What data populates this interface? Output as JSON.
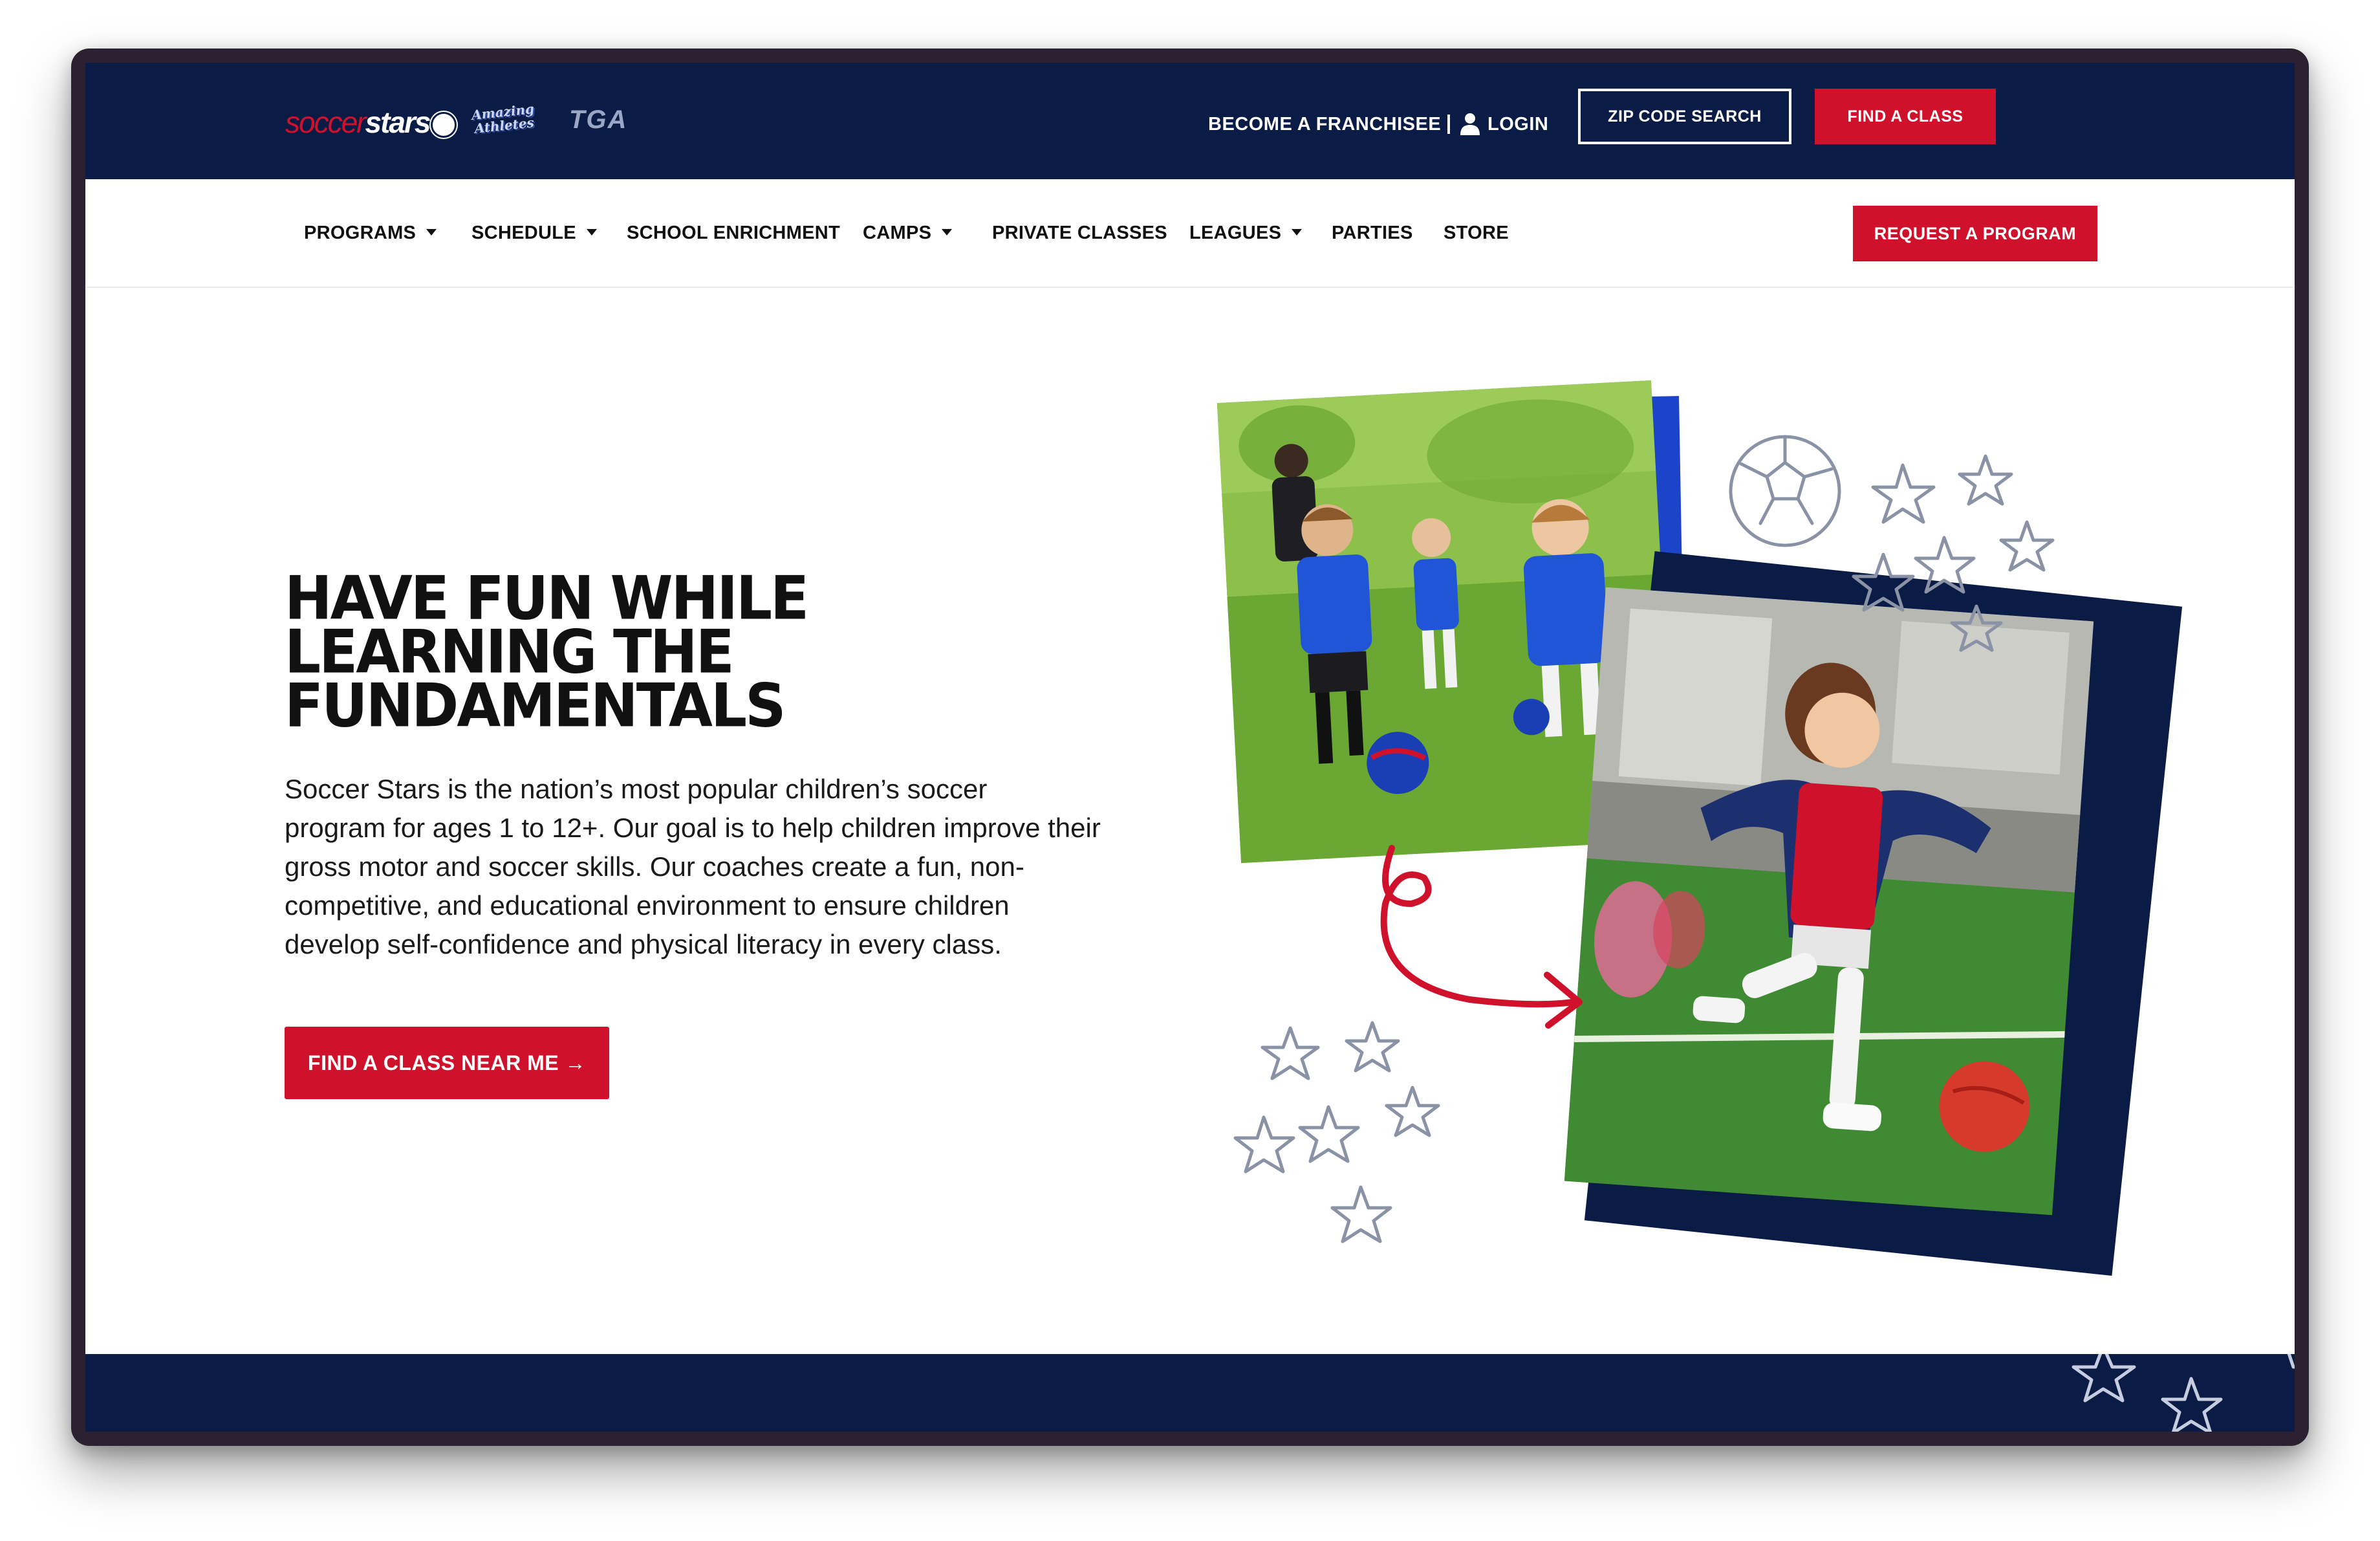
{
  "colors": {
    "navy": "#0a1b45",
    "red": "#d0112b",
    "white": "#ffffff",
    "text": "#111111",
    "photo_blue": "#1c44c8"
  },
  "brand": {
    "logo_primary_a": "soccer",
    "logo_primary_b": "stars",
    "logo_secondary": "Amazing Athletes",
    "logo_tertiary": "TGA"
  },
  "topbar": {
    "franchise_label": "BECOME A FRANCHISEE",
    "login_label": "LOGIN",
    "zip_search_label": "ZIP CODE SEARCH",
    "find_class_label": "FIND A CLASS",
    "icons": [
      "user-icon"
    ]
  },
  "nav": {
    "items": [
      {
        "label": "PROGRAMS",
        "has_dropdown": true
      },
      {
        "label": "SCHEDULE",
        "has_dropdown": true
      },
      {
        "label": "SCHOOL ENRICHMENT",
        "has_dropdown": false
      },
      {
        "label": "CAMPS",
        "has_dropdown": true
      },
      {
        "label": "PRIVATE CLASSES",
        "has_dropdown": false
      },
      {
        "label": "LEAGUES",
        "has_dropdown": true
      },
      {
        "label": "PARTIES",
        "has_dropdown": false
      },
      {
        "label": "STORE",
        "has_dropdown": false
      }
    ],
    "request_label": "REQUEST A PROGRAM"
  },
  "hero": {
    "headline_line1": "HAVE FUN WHILE",
    "headline_line2": "LEARNING THE",
    "headline_line3": "FUNDAMENTALS",
    "body_line1": "Soccer Stars is the nation’s most popular children’s soccer",
    "body_line2": "program for ages 1 to 12+. Our goal is to help children improve their",
    "body_line3": "gross motor and soccer skills. Our coaches create a fun, non-",
    "body_line4": "competitive, and educational environment to ensure children",
    "body_line5": "develop self-confidence and physical literacy in every class.",
    "cta_label": "FIND A CLASS NEAR ME →"
  },
  "images": {
    "photo_top": "kids-playing-soccer-blue-jerseys",
    "photo_bottom": "girl-kicking-soccer-ball-red-jersey",
    "decorations": [
      "soccer-ball-doodle",
      "star-doodles",
      "curly-arrow"
    ]
  }
}
